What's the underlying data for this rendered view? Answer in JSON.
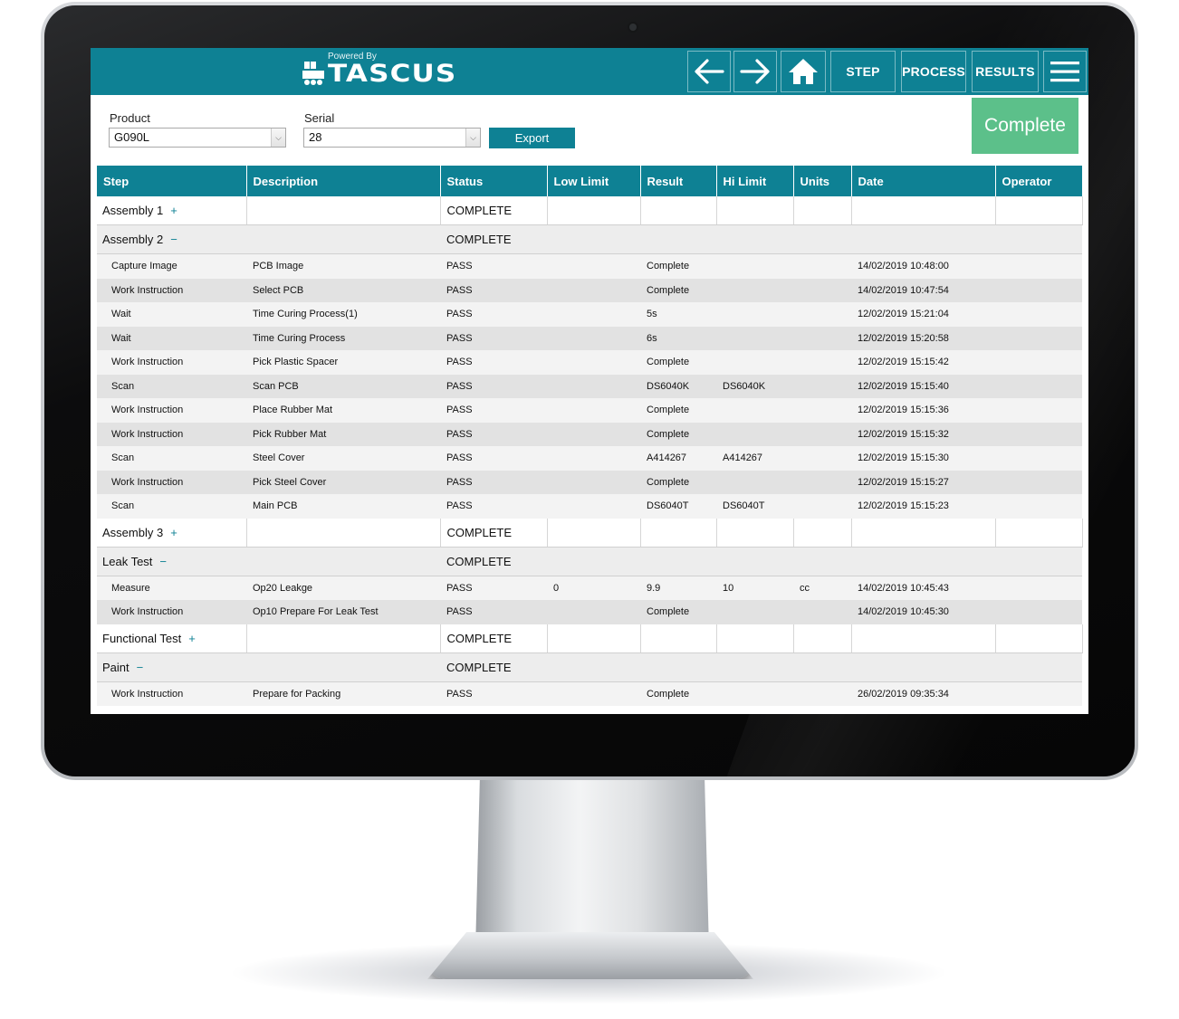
{
  "header": {
    "powered_by": "Powered By",
    "brand": "TASCUS",
    "nav": {
      "step": "STEP",
      "process": "PROCESS",
      "results": "RESULTS"
    }
  },
  "filters": {
    "product_label": "Product",
    "product_value": "G090L",
    "serial_label": "Serial",
    "serial_value": "28",
    "export_label": "Export"
  },
  "status_button": {
    "label": "Complete",
    "color": "#5cc08a"
  },
  "colors": {
    "accent": "#0e8194"
  },
  "table": {
    "columns": [
      "Step",
      "Description",
      "Status",
      "Low Limit",
      "Result",
      "Hi Limit",
      "Units",
      "Date",
      "Operator"
    ],
    "rows": [
      {
        "group": true,
        "name": "Assembly 1",
        "toggle": "+",
        "status": "COMPLETE"
      },
      {
        "group": true,
        "name": "Assembly 2",
        "toggle": "−",
        "status": "COMPLETE"
      },
      {
        "step": "Capture Image",
        "description": "PCB Image",
        "status": "PASS",
        "low": "",
        "result": "Complete",
        "hi": "",
        "units": "",
        "date": "14/02/2019 10:48:00",
        "operator": ""
      },
      {
        "step": "Work Instruction",
        "description": "Select PCB",
        "status": "PASS",
        "low": "",
        "result": "Complete",
        "hi": "",
        "units": "",
        "date": "14/02/2019 10:47:54",
        "operator": ""
      },
      {
        "step": "Wait",
        "description": "Time Curing Process(1)",
        "status": "PASS",
        "low": "",
        "result": "5s",
        "hi": "",
        "units": "",
        "date": "12/02/2019 15:21:04",
        "operator": ""
      },
      {
        "step": "Wait",
        "description": "Time Curing Process",
        "status": "PASS",
        "low": "",
        "result": "6s",
        "hi": "",
        "units": "",
        "date": "12/02/2019 15:20:58",
        "operator": ""
      },
      {
        "step": "Work Instruction",
        "description": "Pick Plastic Spacer",
        "status": "PASS",
        "low": "",
        "result": "Complete",
        "hi": "",
        "units": "",
        "date": "12/02/2019 15:15:42",
        "operator": ""
      },
      {
        "step": "Scan",
        "description": "Scan PCB",
        "status": "PASS",
        "low": "",
        "result": "DS6040K",
        "hi": "DS6040K",
        "units": "",
        "date": "12/02/2019 15:15:40",
        "operator": ""
      },
      {
        "step": "Work Instruction",
        "description": "Place Rubber Mat",
        "status": "PASS",
        "low": "",
        "result": "Complete",
        "hi": "",
        "units": "",
        "date": "12/02/2019 15:15:36",
        "operator": ""
      },
      {
        "step": "Work Instruction",
        "description": "Pick Rubber Mat",
        "status": "PASS",
        "low": "",
        "result": "Complete",
        "hi": "",
        "units": "",
        "date": "12/02/2019 15:15:32",
        "operator": ""
      },
      {
        "step": "Scan",
        "description": "Steel Cover",
        "status": "PASS",
        "low": "",
        "result": "A414267",
        "hi": "A414267",
        "units": "",
        "date": "12/02/2019 15:15:30",
        "operator": ""
      },
      {
        "step": "Work Instruction",
        "description": "Pick Steel Cover",
        "status": "PASS",
        "low": "",
        "result": "Complete",
        "hi": "",
        "units": "",
        "date": "12/02/2019 15:15:27",
        "operator": ""
      },
      {
        "step": "Scan",
        "description": "Main PCB",
        "status": "PASS",
        "low": "",
        "result": "DS6040T",
        "hi": "DS6040T",
        "units": "",
        "date": "12/02/2019 15:15:23",
        "operator": ""
      },
      {
        "group": true,
        "name": "Assembly 3",
        "toggle": "+",
        "status": "COMPLETE"
      },
      {
        "group": true,
        "name": "Leak Test",
        "toggle": "−",
        "status": "COMPLETE"
      },
      {
        "step": "Measure",
        "description": "Op20 Leakge",
        "status": "PASS",
        "low": "0",
        "result": "9.9",
        "hi": "10",
        "units": "cc",
        "date": "14/02/2019 10:45:43",
        "operator": ""
      },
      {
        "step": "Work Instruction",
        "description": "Op10 Prepare For Leak Test",
        "status": "PASS",
        "low": "",
        "result": "Complete",
        "hi": "",
        "units": "",
        "date": "14/02/2019 10:45:30",
        "operator": ""
      },
      {
        "group": true,
        "name": "Functional Test",
        "toggle": "+",
        "status": "COMPLETE"
      },
      {
        "group": true,
        "name": "Paint",
        "toggle": "−",
        "status": "COMPLETE"
      },
      {
        "step": "Work Instruction",
        "description": "Prepare for Packing",
        "status": "PASS",
        "low": "",
        "result": "Complete",
        "hi": "",
        "units": "",
        "date": "26/02/2019 09:35:34",
        "operator": ""
      }
    ]
  }
}
